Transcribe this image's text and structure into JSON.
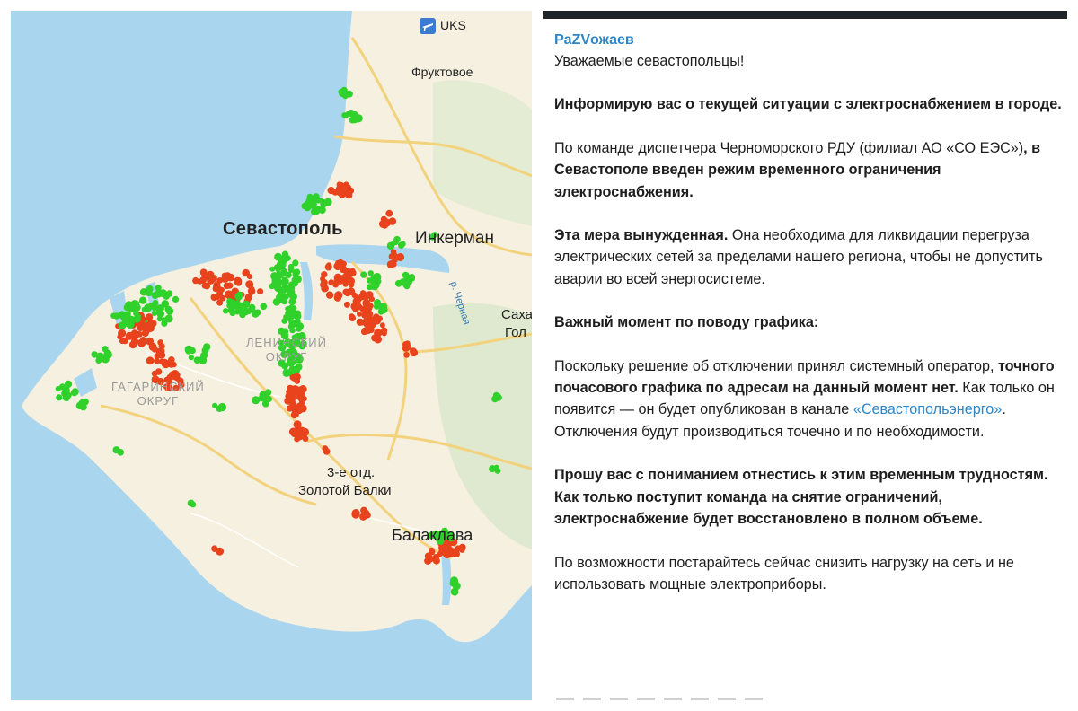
{
  "map": {
    "labels": {
      "airport_code": "UKS",
      "fruktovoe": "Фруктовое",
      "sevastopol": "Севастополь",
      "inkerman": "Инкерман",
      "river": "р. Черная",
      "sakh_1": "Саха",
      "sakh_2": "Гол",
      "leninsky_1": "ЛЕНИНСКИЙ",
      "leninsky_2": "ОКРУГ",
      "gagarinsky_1": "ГАГАРИНСКИЙ",
      "gagarinsky_2": "ОКРУГ",
      "zolotaya_1": "3-е отд.",
      "zolotaya_2": "Золотой Балки",
      "balaklava": "Балаклава"
    },
    "colors": {
      "sea": "#a9d6ee",
      "land": "#f6f0e0",
      "green": "#2fd12a",
      "red": "#e8431c",
      "road": "#f2d27c"
    }
  },
  "message": {
    "author": "PaZVожаев",
    "greeting": "Уважаемые севастопольцы!",
    "p1": "Информирую вас о текущей ситуации с электроснабжением в городе.",
    "p2_a": "По команде диспетчера Черноморского РДУ (филиал АО «СО ЕЭС»)",
    "p2_b": ", в Севастополе введен режим временного ограничения электроснабжения.",
    "p3_a": "Эта мера вынужденная.",
    "p3_b": " Она необходима для ликвидации перегруза электрических сетей за пределами нашего региона, чтобы не допустить аварии во всей энергосистеме.",
    "p4": "Важный момент по поводу графика:",
    "p5_a": "Поскольку решение об отключении принял системный оператор, ",
    "p5_b": "точного почасового графика по адресам на данный момент нет.",
    "p5_c": " Как только он появится — он будет опубликован в канале ",
    "p5_link": "«Севастопольэнерго»",
    "p5_d": ". Отключения будут производиться точечно и по необходимости.",
    "p6": "Прошу вас с пониманием отнестись к этим временным трудностям. Как только поступит команда на снятие ограничений, электроснабжение будет восстановлено в полном объеме.",
    "p7": "По возможности постарайтесь сейчас снизить нагрузку на сеть и не использовать мощные электроприборы."
  }
}
